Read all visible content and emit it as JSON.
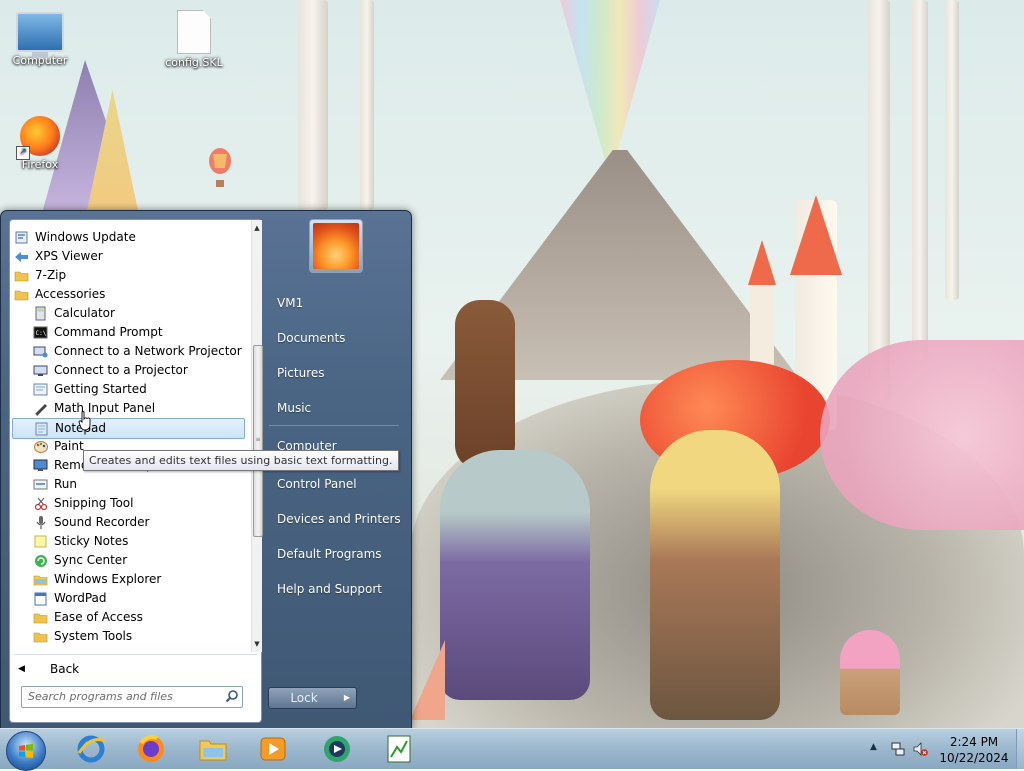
{
  "desktop": {
    "icons": [
      {
        "label": "Computer",
        "icon": "computer-icon"
      },
      {
        "label": "config.SKL",
        "icon": "file-icon"
      },
      {
        "label": "Firefox",
        "icon": "firefox-icon"
      }
    ]
  },
  "start_menu": {
    "programs": [
      {
        "label": "Windows Update",
        "icon": "windows-update-icon",
        "indent": 0
      },
      {
        "label": "XPS Viewer",
        "icon": "xps-viewer-icon",
        "indent": 0
      },
      {
        "label": "7-Zip",
        "icon": "folder-icon",
        "indent": 0
      },
      {
        "label": "Accessories",
        "icon": "folder-icon",
        "indent": 0
      },
      {
        "label": "Calculator",
        "icon": "calculator-icon",
        "indent": 1
      },
      {
        "label": "Command Prompt",
        "icon": "command-prompt-icon",
        "indent": 1
      },
      {
        "label": "Connect to a Network Projector",
        "icon": "network-projector-icon",
        "indent": 1
      },
      {
        "label": "Connect to a Projector",
        "icon": "projector-icon",
        "indent": 1
      },
      {
        "label": "Getting Started",
        "icon": "getting-started-icon",
        "indent": 1
      },
      {
        "label": "Math Input Panel",
        "icon": "math-input-icon",
        "indent": 1
      },
      {
        "label": "Notepad",
        "icon": "notepad-icon",
        "indent": 1,
        "selected": true
      },
      {
        "label": "Paint",
        "icon": "paint-icon",
        "indent": 1
      },
      {
        "label": "Remote Desktop Connection",
        "icon": "remote-desktop-icon",
        "indent": 1
      },
      {
        "label": "Run",
        "icon": "run-icon",
        "indent": 1
      },
      {
        "label": "Snipping Tool",
        "icon": "snipping-tool-icon",
        "indent": 1
      },
      {
        "label": "Sound Recorder",
        "icon": "sound-recorder-icon",
        "indent": 1
      },
      {
        "label": "Sticky Notes",
        "icon": "sticky-notes-icon",
        "indent": 1
      },
      {
        "label": "Sync Center",
        "icon": "sync-center-icon",
        "indent": 1
      },
      {
        "label": "Windows Explorer",
        "icon": "windows-explorer-icon",
        "indent": 1
      },
      {
        "label": "WordPad",
        "icon": "wordpad-icon",
        "indent": 1
      },
      {
        "label": "Ease of Access",
        "icon": "folder-icon",
        "indent": 1
      },
      {
        "label": "System Tools",
        "icon": "folder-icon",
        "indent": 1
      }
    ],
    "back_label": "Back",
    "search_placeholder": "Search programs and files",
    "tooltip": "Creates and edits text files using basic text formatting.",
    "right_items": [
      "VM1",
      "Documents",
      "Pictures",
      "Music",
      "Computer",
      "Control Panel",
      "Devices and Printers",
      "Default Programs",
      "Help and Support"
    ],
    "lock_label": "Lock"
  },
  "taskbar": {
    "pinned": [
      "internet-explorer-icon",
      "firefox-icon",
      "windows-explorer-icon",
      "media-player-icon",
      "media-center-icon",
      "task-scheduler-icon"
    ],
    "clock_time": "2:24 PM",
    "clock_date": "10/22/2024"
  },
  "colors": {
    "start_menu_bg": "#4a6584",
    "taskbar_bg": "#9bb7cd",
    "selection": "#cbe4f8"
  }
}
